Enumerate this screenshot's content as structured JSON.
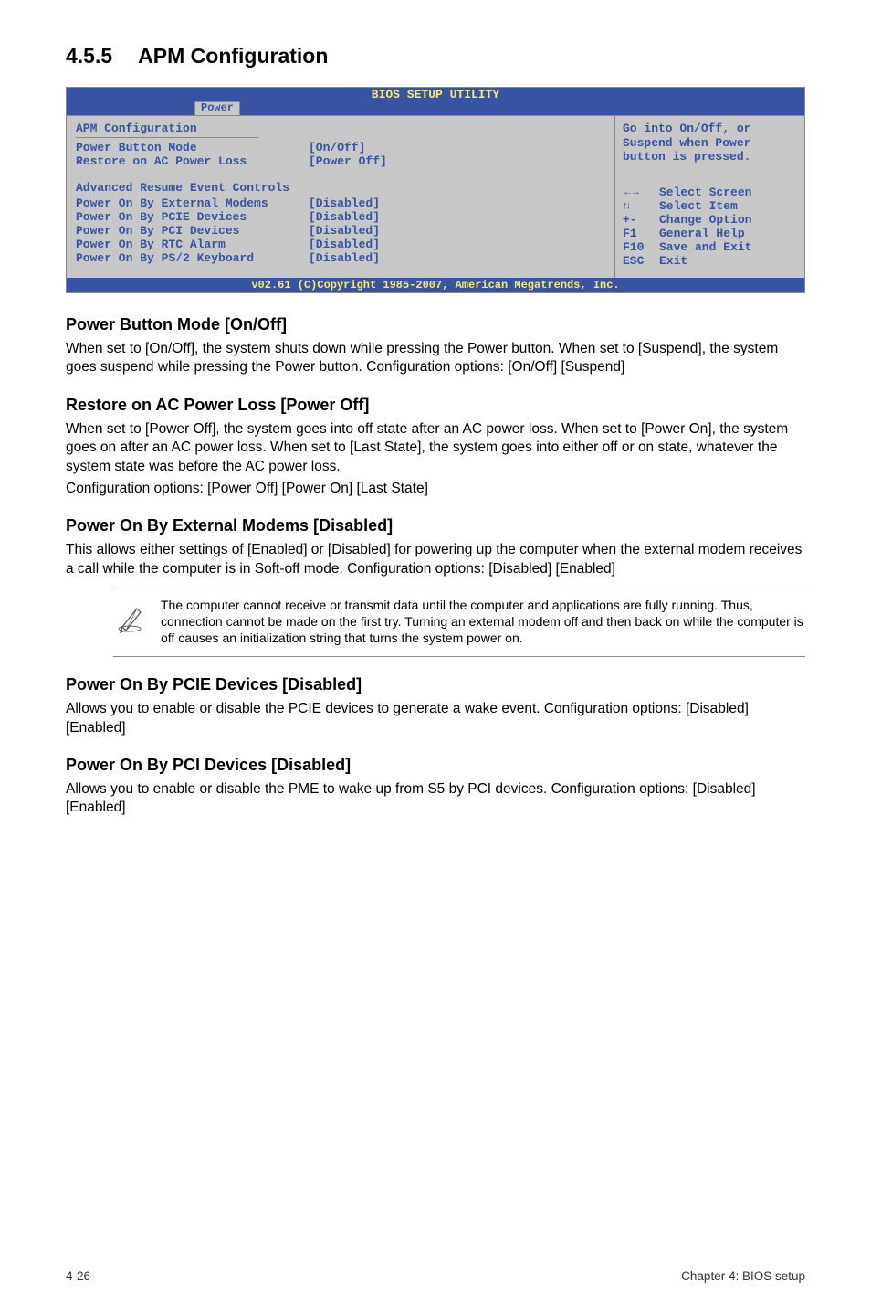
{
  "section": {
    "number": "4.5.5",
    "title": "APM Configuration"
  },
  "bios": {
    "header": "BIOS SETUP UTILITY",
    "tab": "Power",
    "left_title": "APM Configuration",
    "rows1": [
      {
        "label": "Power Button Mode",
        "val": "[On/Off]"
      },
      {
        "label": "Restore on AC Power Loss",
        "val": "[Power Off]"
      }
    ],
    "subhead": "Advanced Resume Event Controls",
    "rows2": [
      {
        "label": "Power On By External Modems",
        "val": "[Disabled]"
      },
      {
        "label": "Power On By PCIE Devices",
        "val": "[Disabled]"
      },
      {
        "label": "Power On By PCI Devices",
        "val": "[Disabled]"
      },
      {
        "label": "Power On By RTC Alarm",
        "val": "[Disabled]"
      },
      {
        "label": "Power On By PS/2 Keyboard",
        "val": "[Disabled]"
      }
    ],
    "help": "Go into On/Off, or Suspend when Power button is pressed.",
    "hints": [
      {
        "key": "←→",
        "text": "Select Screen",
        "arrows": true
      },
      {
        "key": "↑↓",
        "text": "Select Item",
        "arrows": true
      },
      {
        "key": "+-",
        "text": "Change Option"
      },
      {
        "key": "F1",
        "text": "General Help"
      },
      {
        "key": "F10",
        "text": "Save and Exit"
      },
      {
        "key": "ESC",
        "text": "Exit"
      }
    ],
    "footer": "v02.61 (C)Copyright 1985-2007, American Megatrends, Inc."
  },
  "subs": {
    "s1": {
      "h": "Power Button Mode [On/Off]",
      "p": "When set to [On/Off], the system shuts down while pressing the Power button. When set to [Suspend], the system goes suspend while pressing the Power button. Configuration options: [On/Off] [Suspend]"
    },
    "s2": {
      "h": "Restore on AC Power Loss [Power Off]",
      "p1": "When set to [Power Off], the system goes into off state after an AC power loss. When set to [Power On], the system goes on after an AC power loss. When set to [Last State], the system goes into either off or on state, whatever the system state was before the AC power loss.",
      "p2": "Configuration options: [Power Off] [Power On] [Last State]"
    },
    "s3": {
      "h": "Power On By External Modems [Disabled]",
      "p": "This allows either settings of [Enabled] or [Disabled] for powering up the computer when the external modem receives a call while the computer is in Soft-off mode. Configuration options: [Disabled] [Enabled]"
    },
    "note": "The computer cannot receive or transmit data until the computer and applications are fully running. Thus, connection cannot be made on the first try. Turning an external modem off and then back on while the computer is off causes an initialization string that turns the system power on.",
    "s4": {
      "h": "Power On By PCIE Devices [Disabled]",
      "p": "Allows you to enable or disable the PCIE devices to generate a wake event. Configuration options: [Disabled] [Enabled]"
    },
    "s5": {
      "h": "Power On By PCI Devices [Disabled]",
      "p": "Allows you to enable or disable the PME to wake up from S5 by PCI devices. Configuration options: [Disabled] [Enabled]"
    }
  },
  "footer": {
    "left": "4-26",
    "right": "Chapter 4: BIOS setup"
  }
}
